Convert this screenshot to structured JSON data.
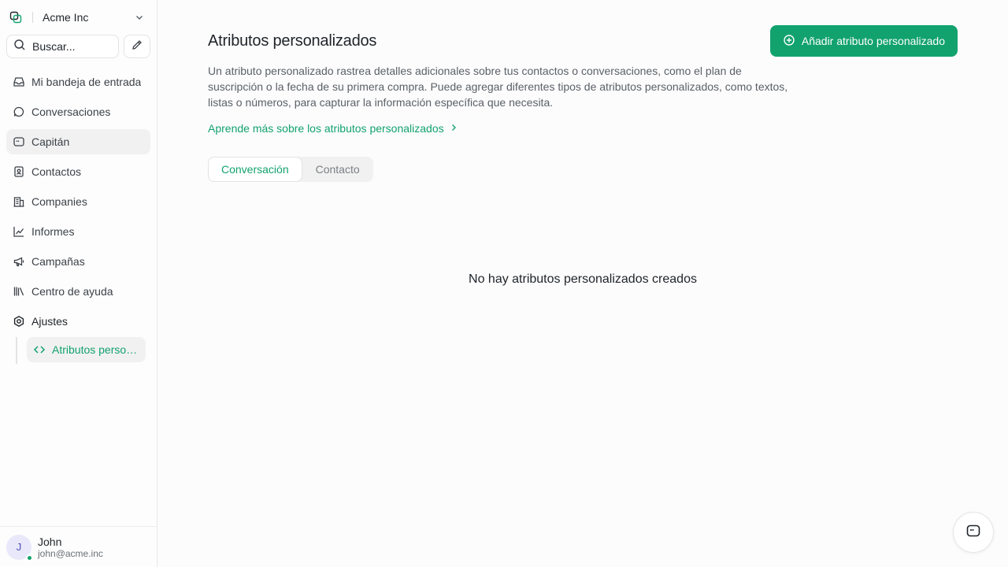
{
  "workspace": {
    "name": "Acme Inc"
  },
  "search": {
    "placeholder": "Buscar..."
  },
  "sidebar": {
    "items": [
      {
        "label": "Mi bandeja de entrada",
        "icon": "inbox-icon"
      },
      {
        "label": "Conversaciones",
        "icon": "chat-bubble-icon"
      },
      {
        "label": "Capitán",
        "icon": "bot-icon"
      },
      {
        "label": "Contactos",
        "icon": "contact-card-icon"
      },
      {
        "label": "Companies",
        "icon": "building-icon"
      },
      {
        "label": "Informes",
        "icon": "line-chart-icon"
      },
      {
        "label": "Campañas",
        "icon": "megaphone-icon"
      },
      {
        "label": "Centro de ayuda",
        "icon": "library-icon"
      },
      {
        "label": "Ajustes",
        "icon": "gear-icon"
      }
    ],
    "subitems": [
      {
        "label": "Atributos personalizados",
        "icon": "code-icon"
      }
    ]
  },
  "profile": {
    "initial": "J",
    "name": "John",
    "email": "john@acme.inc"
  },
  "main": {
    "title": "Atributos personalizados",
    "add_button": "Añadir atributo personalizado",
    "description": "Un atributo personalizado rastrea detalles adicionales sobre tus contactos o conversaciones, como el plan de suscripción o la fecha de su primera compra. Puede agregar diferentes tipos de atributos personalizados, como textos, listas o números, para capturar la información específica que necesita.",
    "learn_link": "Aprende más sobre los atributos personalizados",
    "tabs": [
      {
        "label": "Conversación",
        "active": true
      },
      {
        "label": "Contacto",
        "active": false
      }
    ],
    "empty_state": "No hay atributos personalizados creados"
  },
  "colors": {
    "accent": "#12a26e",
    "sidebar_active_bg": "#f1f1f1"
  }
}
